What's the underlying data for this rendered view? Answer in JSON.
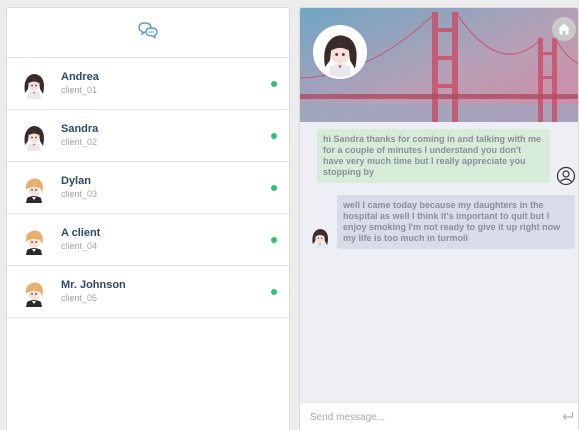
{
  "contacts": [
    {
      "name": "Andrea",
      "id": "client_01",
      "online": true
    },
    {
      "name": "Sandra",
      "id": "client_02",
      "online": true
    },
    {
      "name": "Dylan",
      "id": "client_03",
      "online": true
    },
    {
      "name": "A client",
      "id": "client_04",
      "online": true
    },
    {
      "name": "Mr. Johnson",
      "id": "client_05",
      "online": true
    }
  ],
  "chat": {
    "messages": [
      {
        "from": "me",
        "text": "hi Sandra thanks for coming in and talking with me for a couple of minutes I understand you don't have very much time but I really appreciate you stopping by"
      },
      {
        "from": "client",
        "text": "well I came today because my daughters in the hospital as well I think it's important to quit but I enjoy smoking I'm not ready to give it up right now my life is too much in turmoil"
      }
    ],
    "input_placeholder": "Send message..."
  },
  "icons": {
    "header": "chat-bubbles-icon",
    "home": "home-icon",
    "me": "user-outline-icon",
    "send": "enter-return-icon"
  },
  "colors": {
    "online": "#2cc36b",
    "name": "#2e4a66",
    "outgoing_bubble": "#d6ecd9",
    "incoming_bubble": "#d8dce8",
    "accent": "#5b9bd5"
  }
}
